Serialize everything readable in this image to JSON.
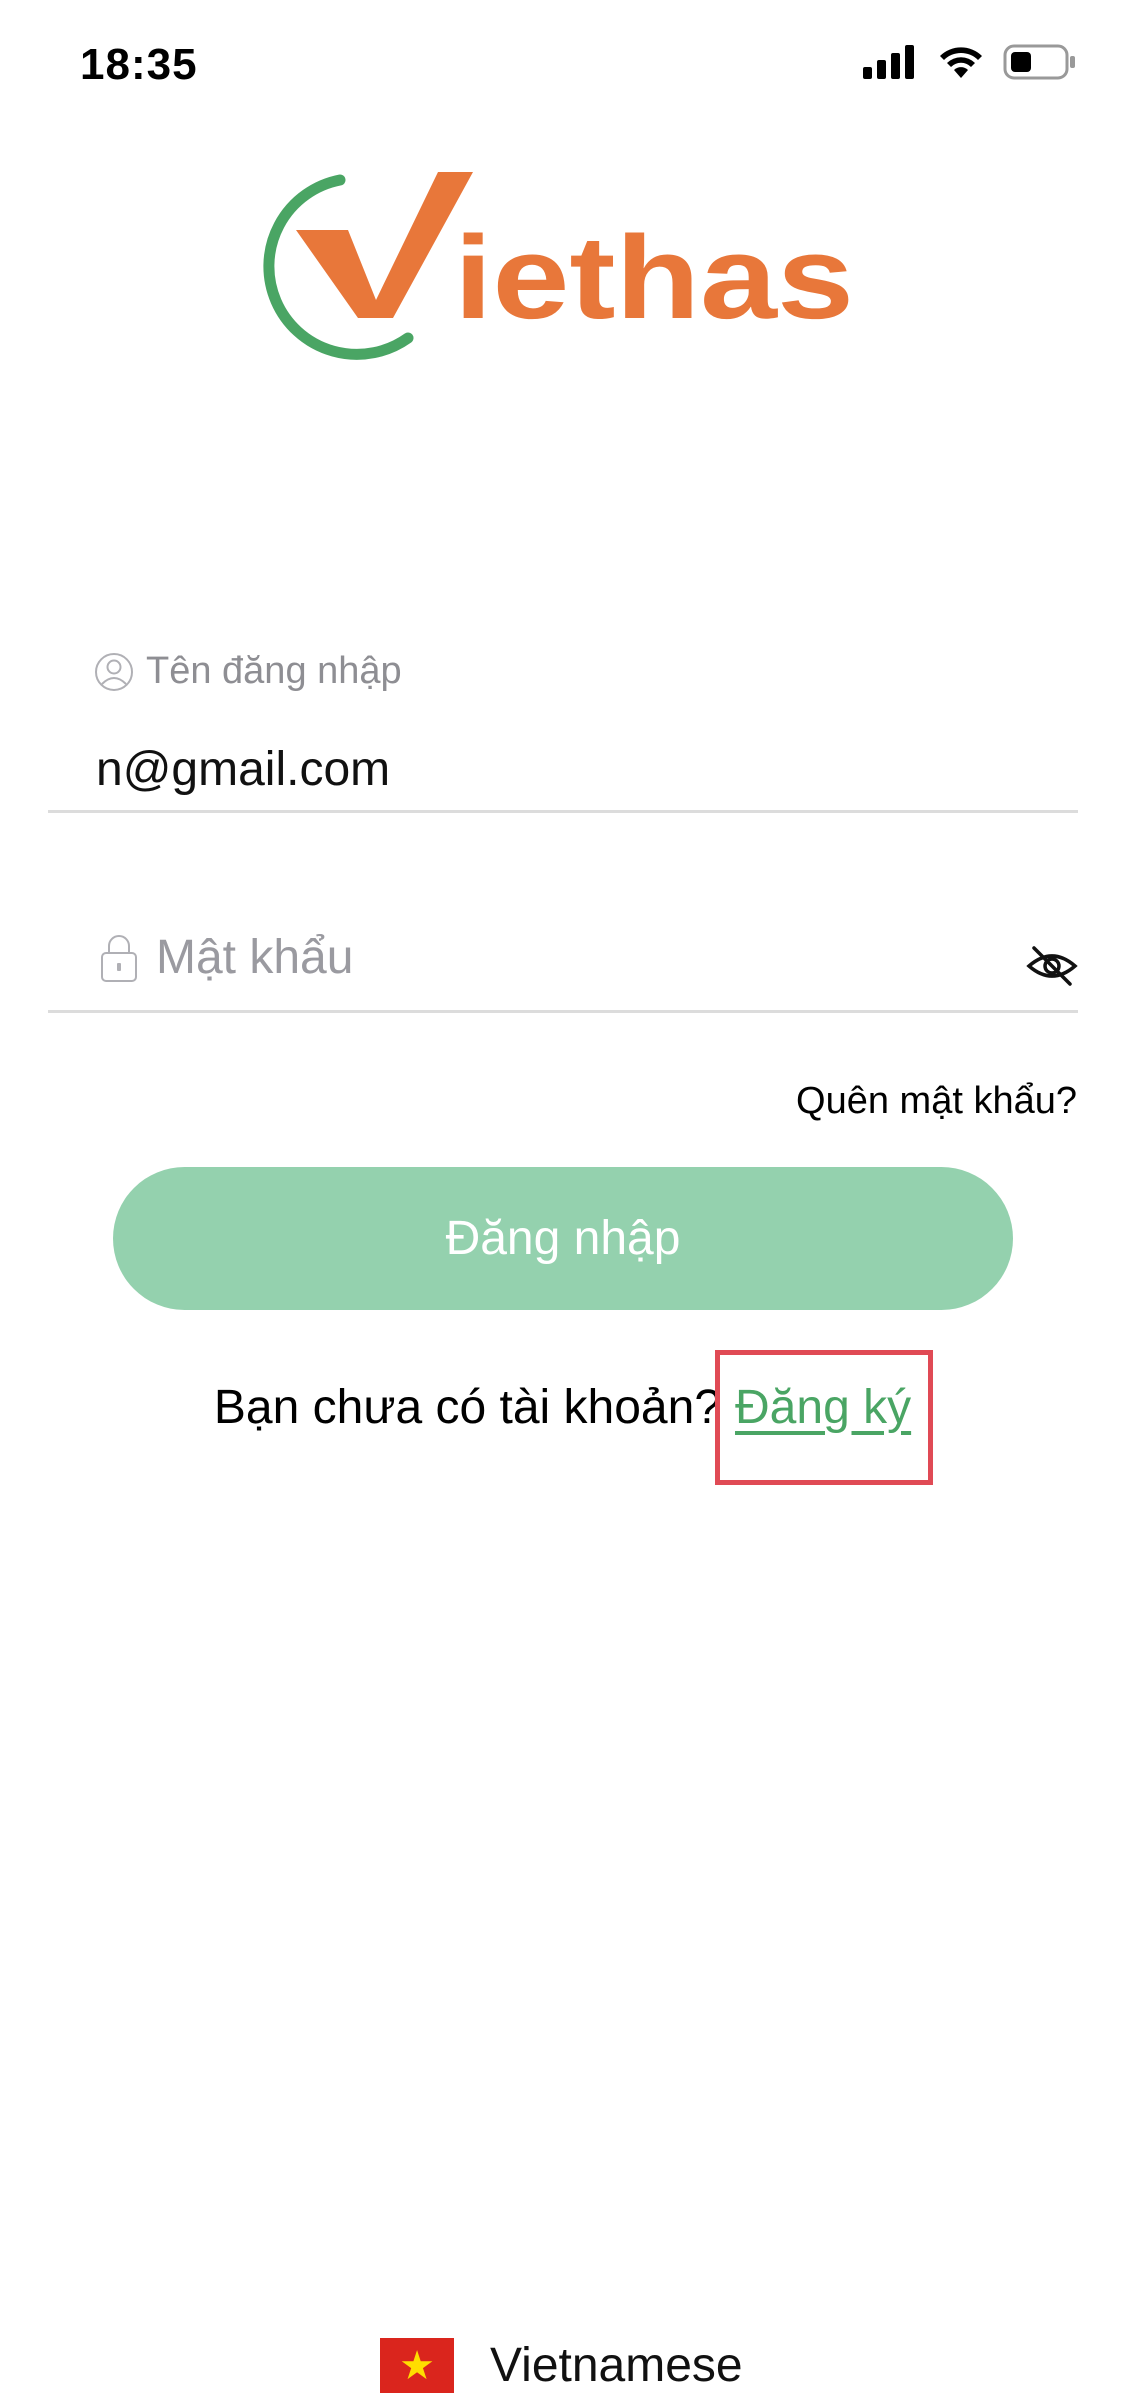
{
  "status_bar": {
    "time": "18:35",
    "icons": [
      "signal-icon",
      "wifi-icon",
      "battery-icon"
    ]
  },
  "brand": {
    "logo_text": "Viethas",
    "colors": {
      "orange": "#e8773a",
      "green": "#4aa564"
    }
  },
  "login_form": {
    "username": {
      "icon": "user-icon",
      "label": "Tên đăng nhập",
      "value": "n@gmail.com"
    },
    "password": {
      "icon": "lock-icon",
      "placeholder": "Mật khẩu",
      "toggle_icon": "eye-off-icon"
    },
    "forgot_password": "Quên mật khẩu?",
    "login_button": "Đăng nhập",
    "login_button_color": "#94d1ae",
    "signup_prompt": "Bạn chưa có tài khoản?",
    "signup_link": "Đăng ký",
    "highlight_color": "#e04a55"
  },
  "language_selector": {
    "flag_icon": "vietnam-flag-icon",
    "label": "Vietnamese"
  }
}
